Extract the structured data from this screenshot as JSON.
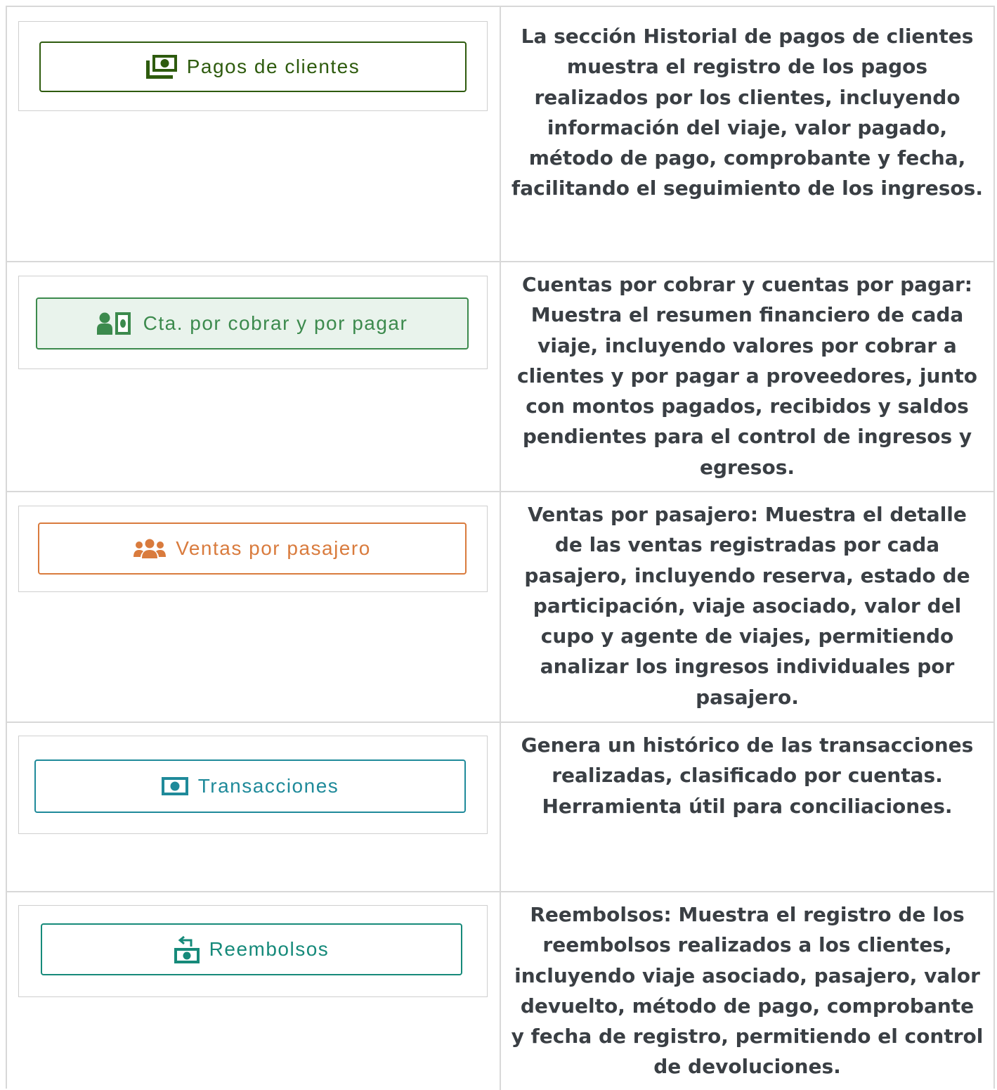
{
  "colors": {
    "pagos": "#2e5b0e",
    "cuentas_text": "#3c8a4d",
    "cuentas_bg": "#e9f3ec",
    "ventas": "#d97b3d",
    "transacciones": "#1f8a9a",
    "reembolsos": "#168a7a"
  },
  "rows": [
    {
      "button_label": "Pagos de clientes",
      "icon": "money-stack-icon",
      "description": "La sección Historial de pagos de clientes muestra el registro de los pagos realizados por los clientes, incluyendo información del viaje, valor pagado, método de pago, comprobante y fecha, facilitando el seguimiento de los ingresos."
    },
    {
      "button_label": "Cta. por cobrar y por pagar",
      "icon": "user-money-icon",
      "description": "Cuentas por cobrar y cuentas por pagar: Muestra el resumen financiero de cada viaje, incluyendo valores por cobrar a clientes y por pagar a proveedores, junto con montos pagados, recibidos y saldos pendientes para el control de ingresos y egresos."
    },
    {
      "button_label": "Ventas por pasajero",
      "icon": "users-icon",
      "description": "Ventas por pasajero: Muestra el detalle de las ventas registradas por cada pasajero, incluyendo reserva, estado de participación, viaje asociado, valor del cupo y agente de viajes, permitiendo analizar los ingresos individuales por pasajero."
    },
    {
      "button_label": "Transacciones",
      "icon": "money-bill-icon",
      "description": "Genera un histórico de las transacciones realizadas, clasificado por cuentas. Herramienta útil para conciliaciones."
    },
    {
      "button_label": "Reembolsos",
      "icon": "refund-icon",
      "description": "Reembolsos: Muestra el registro de los reembolsos realizados a los clientes, incluyendo viaje asociado, pasajero, valor devuelto, método de pago, comprobante y fecha de registro, permitiendo el control de devoluciones."
    }
  ]
}
